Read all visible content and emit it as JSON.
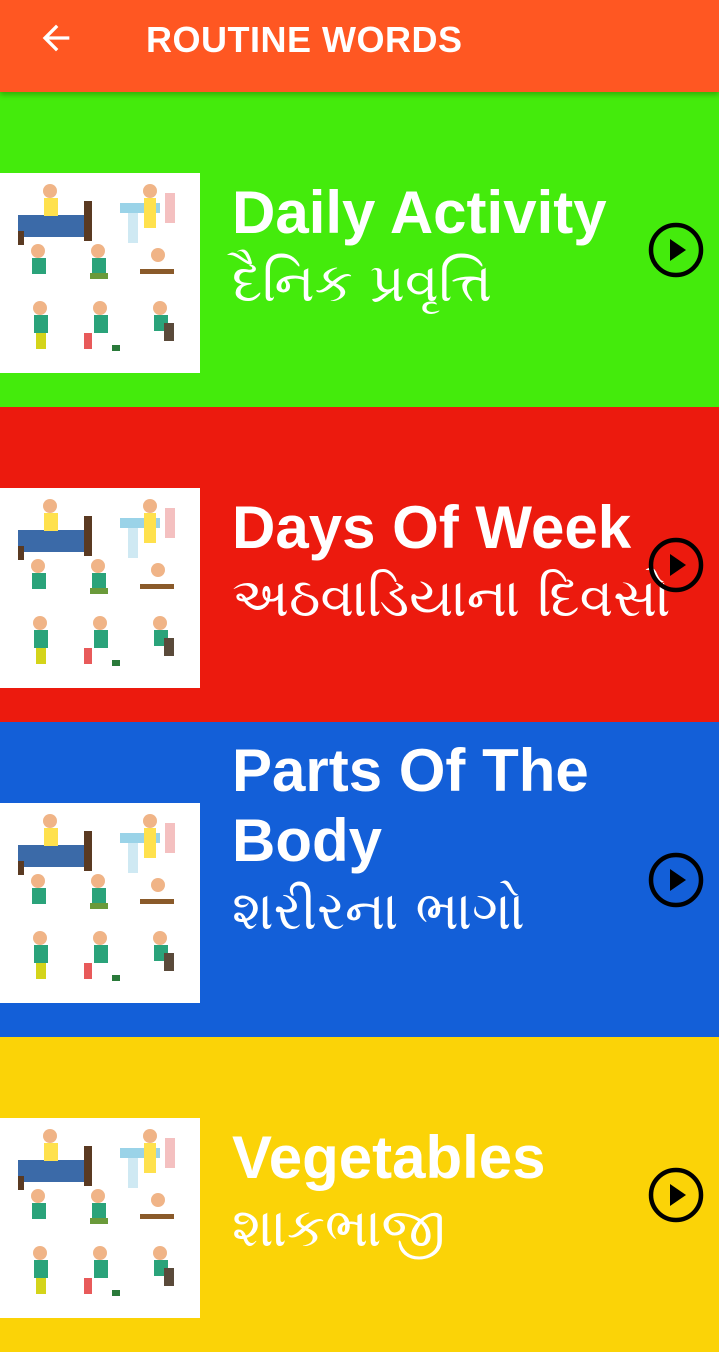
{
  "appbar": {
    "title": "ROUTINE WORDS",
    "back_icon": "arrow-left-icon",
    "background": "#FF5722"
  },
  "items": [
    {
      "title_en": "Daily Activity",
      "title_gu": "દૈનિક પ્રવૃત્તિ",
      "background": "#44EB0C",
      "thumbnail": "daily-routine-kids-illustration",
      "play_icon": "play-circle-icon"
    },
    {
      "title_en": "Days Of Week",
      "title_gu": "અઠવાડિયાના દિવસો",
      "background": "#EC1A0E",
      "thumbnail": "daily-routine-kids-illustration",
      "play_icon": "play-circle-icon"
    },
    {
      "title_en": "Parts Of The Body",
      "title_gu": "શરીરના ભાગો",
      "background": "#135FD8",
      "thumbnail": "daily-routine-kids-illustration",
      "play_icon": "play-circle-icon"
    },
    {
      "title_en": "Vegetables",
      "title_gu": "શાકભાજી",
      "background": "#FBD307",
      "thumbnail": "daily-routine-kids-illustration",
      "play_icon": "play-circle-icon"
    }
  ]
}
